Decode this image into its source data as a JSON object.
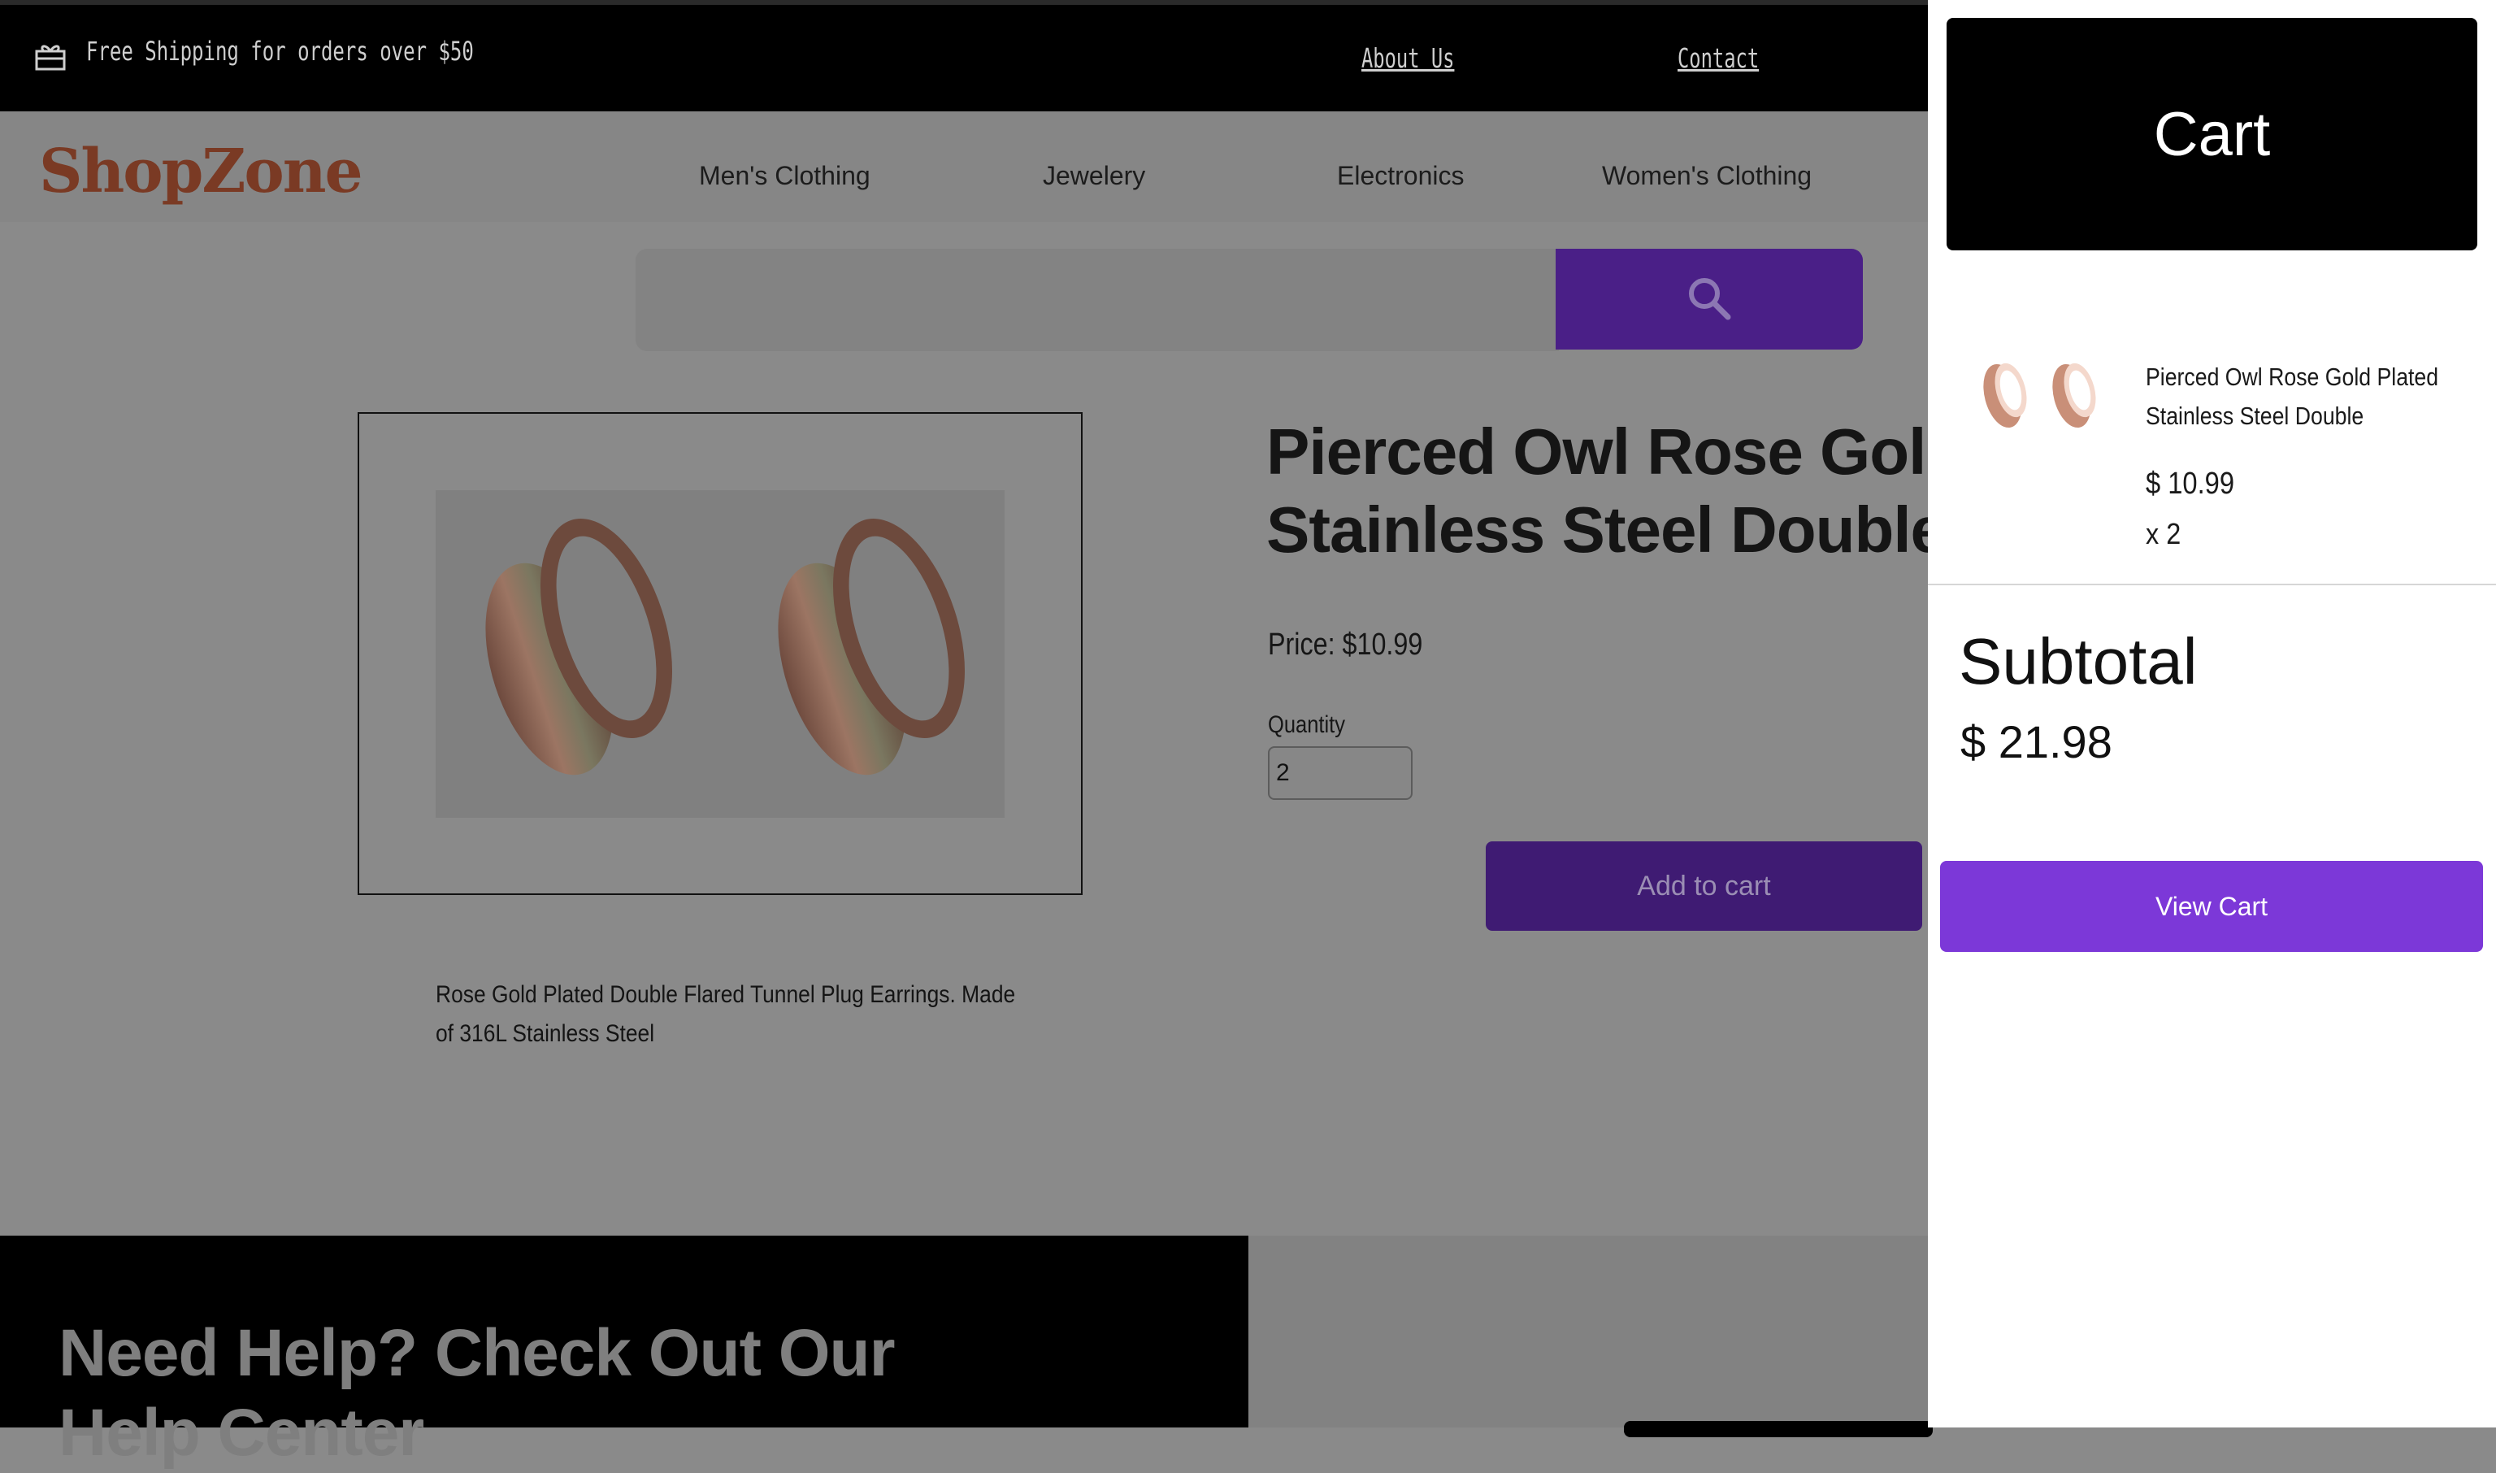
{
  "announcement": {
    "icon": "gift-icon",
    "text": "Free Shipping for orders over $50"
  },
  "top_links": {
    "about": "About Us",
    "contact": "Contact"
  },
  "brand": {
    "logo": "ShopZone",
    "color": "#7a3a24"
  },
  "nav": {
    "items": [
      "Men's Clothing",
      "Jewelery",
      "Electronics",
      "Women's Clothing"
    ]
  },
  "search": {
    "placeholder": "",
    "icon": "search-icon",
    "button_color": "#4a1f87"
  },
  "product": {
    "title_line1": "Pierced Owl Rose Gold",
    "title_line2": "Stainless Steel Double",
    "price": "Price: $10.99",
    "quantity_label": "Quantity",
    "quantity_value": "2",
    "add_to_cart": "Add to cart",
    "description": "Rose Gold Plated Double Flared Tunnel Plug Earrings. Made of 316L Stainless Steel"
  },
  "footer": {
    "help_title_line1": "Need Help? Check Out Our",
    "help_title_line2": "Help Center"
  },
  "cart": {
    "title": "Cart",
    "items": [
      {
        "name": "Pierced Owl Rose Gold Plated Stainless Steel Double",
        "price": "$ 10.99",
        "quantity": "x 2"
      }
    ],
    "subtotal_label": "Subtotal",
    "subtotal_value": "$ 21.98",
    "view_cart": "View Cart",
    "accent": "#7c38d8"
  }
}
